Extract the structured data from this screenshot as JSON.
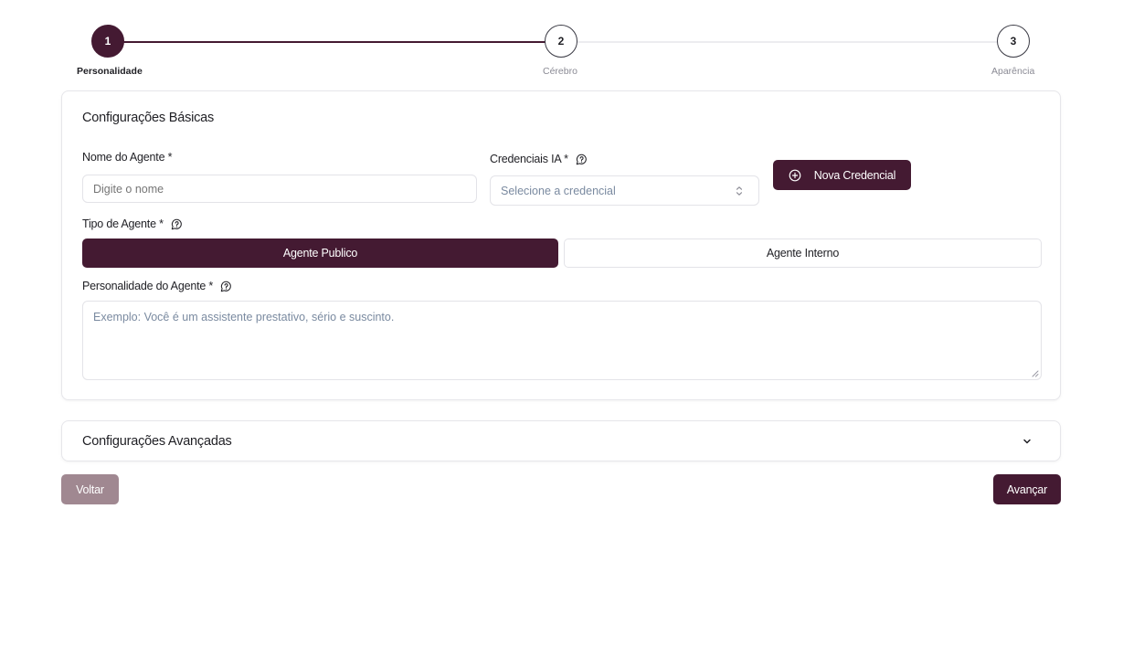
{
  "colors": {
    "brand": "#441a32",
    "brand_muted": "#a08891",
    "border": "#e3e3e8",
    "placeholder": "#7a8aa0"
  },
  "stepper": {
    "steps": [
      {
        "number": "1",
        "label": "Personalidade",
        "state": "active"
      },
      {
        "number": "2",
        "label": "Cérebro",
        "state": "pending"
      },
      {
        "number": "3",
        "label": "Aparência",
        "state": "pending"
      }
    ]
  },
  "basic": {
    "title": "Configurações Básicas",
    "agent_name": {
      "label": "Nome do Agente *",
      "placeholder": "Digite o nome",
      "value": ""
    },
    "credentials": {
      "label": "Credenciais IA *",
      "selected": "Selecione a credencial",
      "help_icon": "message-help-icon"
    },
    "new_credential_button": {
      "label": "Nova Credencial",
      "icon": "plus-circle-icon"
    },
    "agent_type": {
      "label": "Tipo de Agente *",
      "help_icon": "message-help-icon",
      "options": [
        {
          "label": "Agente Publico",
          "selected": true
        },
        {
          "label": "Agente Interno",
          "selected": false
        }
      ]
    },
    "personality": {
      "label": "Personalidade do Agente *",
      "placeholder": "Exemplo: Você é um assistente prestativo, sério e suscinto.",
      "help_icon": "message-help-icon"
    }
  },
  "advanced": {
    "title": "Configurações Avançadas",
    "expanded": false,
    "icon": "chevron-down-icon"
  },
  "footer": {
    "back_label": "Voltar",
    "next_label": "Avançar"
  }
}
